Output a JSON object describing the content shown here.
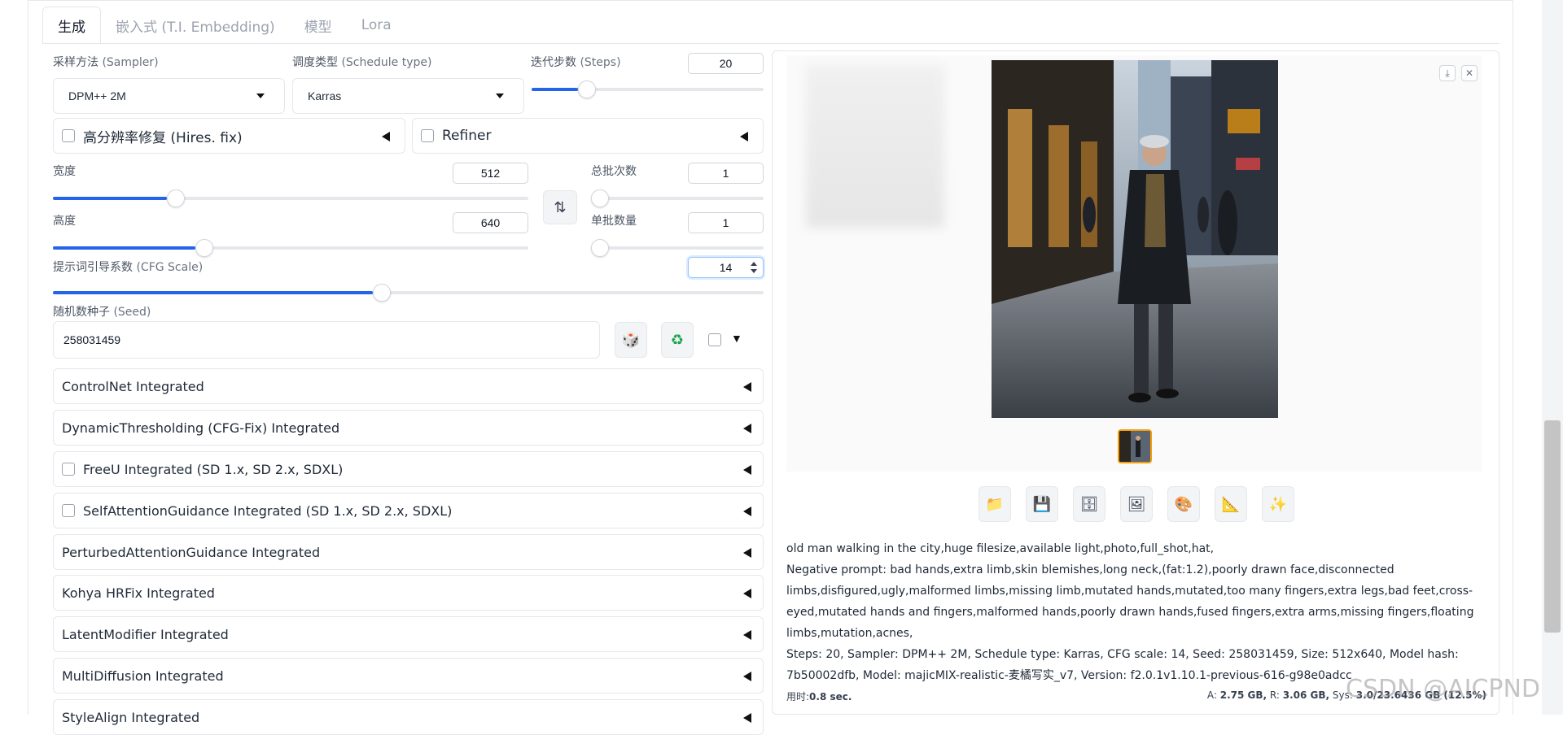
{
  "tabs": [
    "生成",
    "嵌入式 (T.I. Embedding)",
    "模型",
    "Lora"
  ],
  "sampler": {
    "label": "采样方法",
    "label_en": "(Sampler)",
    "value": "DPM++ 2M"
  },
  "schedule": {
    "label": "调度类型",
    "label_en": "(Schedule type)",
    "value": "Karras"
  },
  "steps": {
    "label": "迭代步数",
    "label_en": "(Steps)",
    "value": "20",
    "level": 0.2
  },
  "hires": {
    "label": "高分辨率修复 (Hires. fix)"
  },
  "refiner": {
    "label": "Refiner"
  },
  "width": {
    "label": "宽度",
    "value": "512",
    "level": 0.24
  },
  "height": {
    "label": "高度",
    "value": "640",
    "level": 0.3
  },
  "batch_count": {
    "label": "总批次数",
    "value": "1",
    "level": 0.0
  },
  "batch_size": {
    "label": "单批数量",
    "value": "1",
    "level": 0.0
  },
  "cfg": {
    "label": "提示词引导系数",
    "label_en": "(CFG Scale)",
    "value": "14",
    "level": 0.45
  },
  "seed": {
    "label": "随机数种子",
    "label_en": "(Seed)",
    "value": "258031459"
  },
  "accordions": [
    {
      "label": "ControlNet Integrated",
      "checkbox": false
    },
    {
      "label": "DynamicThresholding (CFG-Fix) Integrated",
      "checkbox": false
    },
    {
      "label": "FreeU Integrated (SD 1.x, SD 2.x, SDXL)",
      "checkbox": true
    },
    {
      "label": "SelfAttentionGuidance Integrated (SD 1.x, SD 2.x, SDXL)",
      "checkbox": true
    },
    {
      "label": "PerturbedAttentionGuidance Integrated",
      "checkbox": false
    },
    {
      "label": "Kohya HRFix Integrated",
      "checkbox": false
    },
    {
      "label": "LatentModifier Integrated",
      "checkbox": false
    },
    {
      "label": "MultiDiffusion Integrated",
      "checkbox": false
    },
    {
      "label": "StyleAlign Integrated",
      "checkbox": false
    }
  ],
  "icons": {
    "dice": "dice-icon",
    "recycle": "recycle-icon",
    "swap": "swap-icon",
    "actions": [
      "folder-icon",
      "save-icon",
      "zip-icon",
      "image-icon",
      "palette-icon",
      "ruler-icon",
      "sparkle-icon"
    ]
  },
  "info": {
    "prompt": "old man walking in the city,huge filesize,available light,photo,full_shot,hat,",
    "negative": "Negative prompt: bad hands,extra limb,skin blemishes,long neck,(fat:1.2),poorly drawn face,disconnected limbs,disfigured,ugly,malformed limbs,missing limb,mutated hands,mutated,too many fingers,extra legs,bad feet,cross-eyed,mutated hands and fingers,malformed hands,poorly drawn hands,fused fingers,extra arms,missing fingers,floating limbs,mutation,acnes,",
    "params": "Steps: 20, Sampler: DPM++ 2M, Schedule type: Karras, CFG scale: 14, Seed: 258031459, Size: 512x640, Model hash: 7b50002dfb, Model: majicMIX-realistic-麦橘写实_v7, Version: f2.0.1v1.10.1-previous-616-g98e0adcc"
  },
  "stats": {
    "time_label": "用时:",
    "time_value": "0.8 sec.",
    "a_label": "A:",
    "a_value": "2.75 GB,",
    "r_label": "R:",
    "r_value": "3.06 GB,",
    "sys_label": "Sys:",
    "sys_value": "3.0/23.6436 GB (12.5%)"
  },
  "watermark": "CSDN @AICPND",
  "colors": {
    "accent": "#2563eb",
    "selected_thumb": "#f59e0b"
  }
}
